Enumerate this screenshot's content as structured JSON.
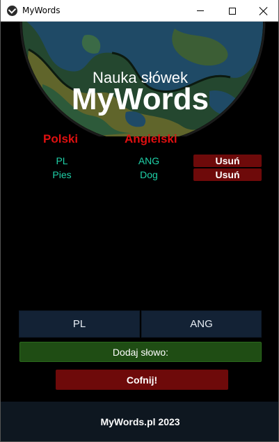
{
  "window": {
    "title": "MyWords",
    "controls": {
      "minimize": "minimize",
      "maximize": "maximize",
      "close": "close"
    }
  },
  "header": {
    "subtitle": "Nauka słówek",
    "title": "MyWords"
  },
  "table": {
    "headers": {
      "polish": "Polski",
      "english": "Angielski"
    },
    "rows": [
      {
        "pl": "PL",
        "en": "ANG",
        "delete_label": "Usuń"
      },
      {
        "pl": "Pies",
        "en": "Dog",
        "delete_label": "Usuń"
      }
    ]
  },
  "form": {
    "pl_placeholder": "PL",
    "en_placeholder": "ANG",
    "add_label": "Dodaj słowo:",
    "undo_label": "Cofnij!"
  },
  "footer": {
    "text": "MyWords.pl 2023"
  },
  "colors": {
    "header_red": "#e01010",
    "cell_teal": "#1fd1a8",
    "delete_bg": "#6e0a0a",
    "add_bg": "#1f4d14",
    "input_bg": "#132235",
    "footer_bg": "#0e1720"
  }
}
